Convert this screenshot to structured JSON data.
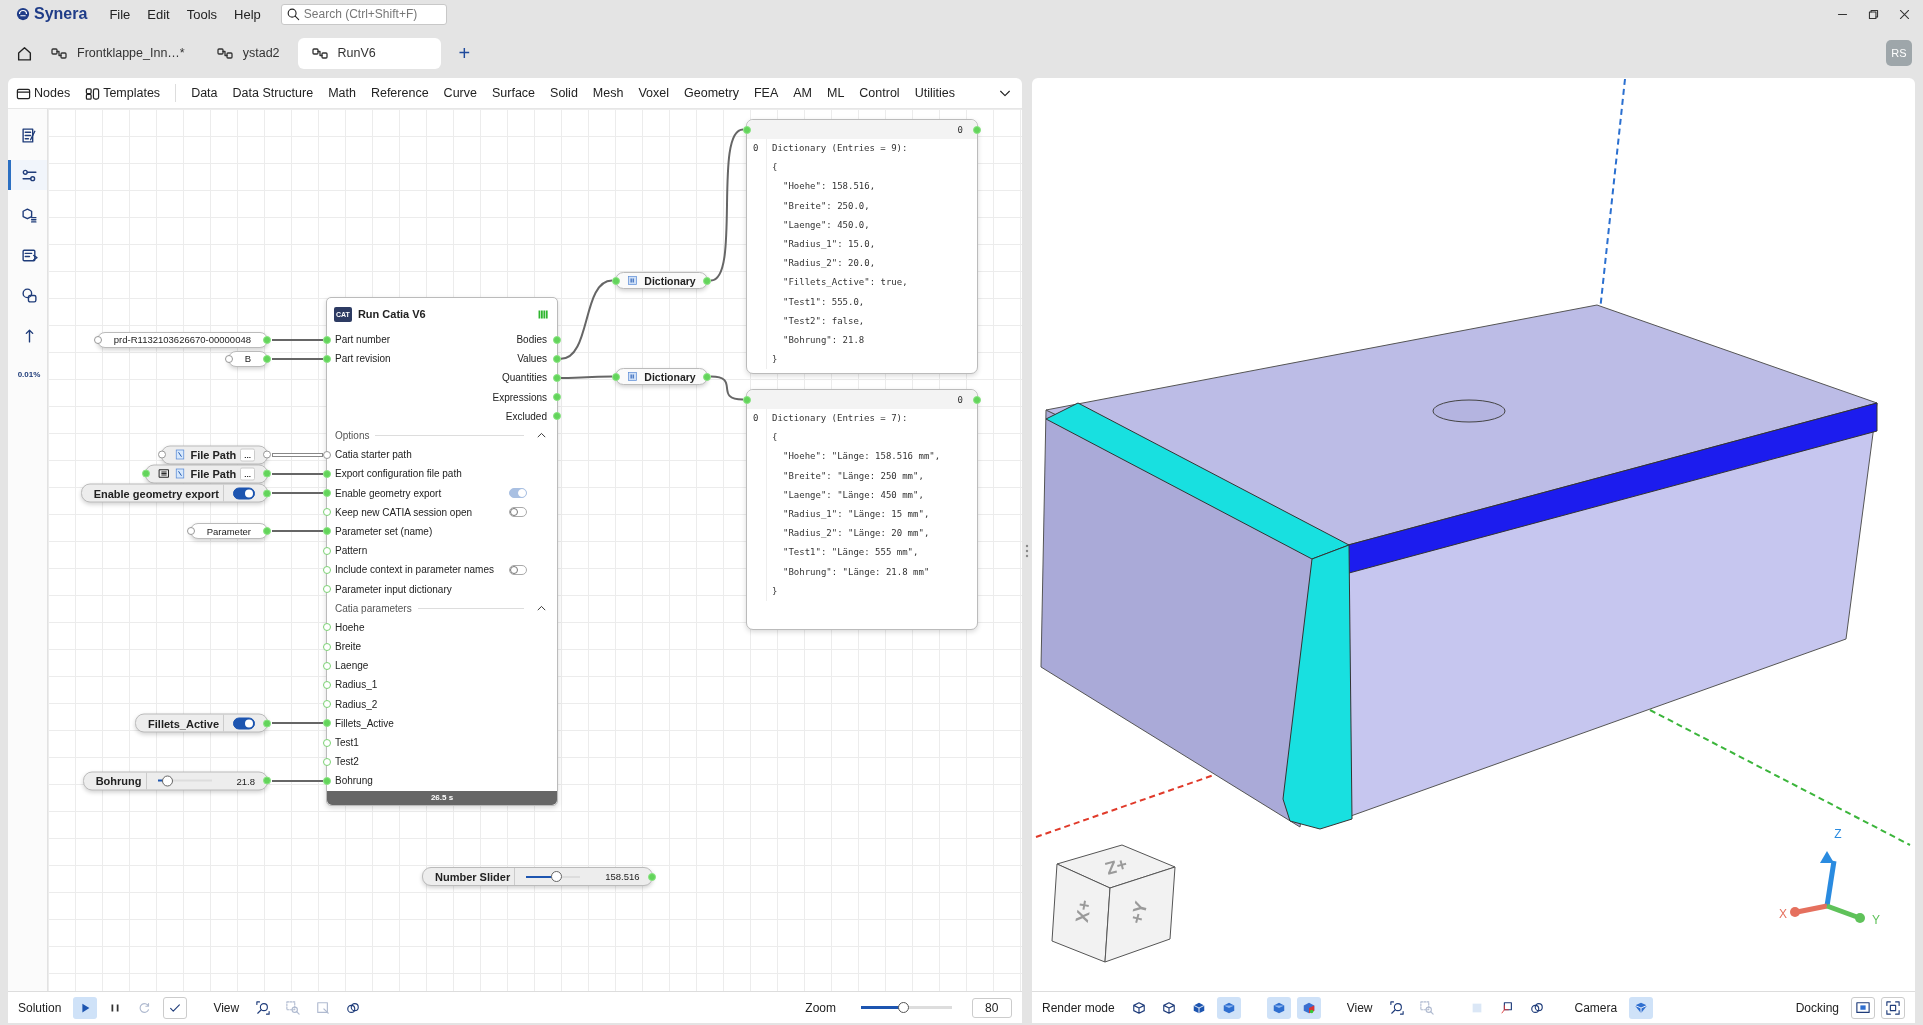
{
  "app": {
    "name": "Synera",
    "menu": [
      "File",
      "Edit",
      "Tools",
      "Help"
    ],
    "search": {
      "placeholder": "Search (Ctrl+Shift+F)"
    }
  },
  "tabs": [
    {
      "label": "Frontklappe_Inn…*",
      "selected": false
    },
    {
      "label": "ystad2",
      "selected": false
    },
    {
      "label": "RunV6",
      "selected": true
    }
  ],
  "add_tab": "+",
  "user": {
    "initials": "RS"
  },
  "node_toolbar": {
    "items": [
      {
        "kind": "nodes",
        "label": "Nodes"
      },
      {
        "kind": "templates",
        "label": "Templates"
      }
    ],
    "categories": [
      "Data",
      "Data Structure",
      "Math",
      "Reference",
      "Curve",
      "Surface",
      "Solid",
      "Mesh",
      "Voxel",
      "Geometry",
      "FEA",
      "AM",
      "ML",
      "Control",
      "Utilities"
    ]
  },
  "sidebar": {
    "items": [
      {
        "kind": "notes",
        "selected": false
      },
      {
        "kind": "sliders",
        "selected": true
      },
      {
        "kind": "cube-list",
        "selected": false
      },
      {
        "kind": "panel",
        "selected": false
      },
      {
        "kind": "shapes",
        "selected": false
      },
      {
        "kind": "arrow-up",
        "selected": false
      },
      {
        "kind": "format",
        "selected": false,
        "label": "0.01%"
      }
    ]
  },
  "canvas": {
    "node": {
      "badge": "CAT",
      "title": "Run Catia V6",
      "duration": "26.5 s",
      "rows": [
        {
          "kind": "port",
          "input": "Part number",
          "output": "Bodies",
          "connected": true,
          "source": {
            "kind": "text",
            "value": "prd-R1132103626670-00000048"
          }
        },
        {
          "kind": "port",
          "input": "Part revision",
          "output": "Values",
          "output_connected": true,
          "connected": true,
          "source": {
            "kind": "text",
            "value": "B"
          }
        },
        {
          "kind": "port",
          "output": "Quantities",
          "output_connected": true
        },
        {
          "kind": "port",
          "output": "Expressions"
        },
        {
          "kind": "port",
          "output": "Excluded"
        },
        {
          "kind": "section",
          "label": "Options",
          "expanded": true
        },
        {
          "kind": "port",
          "input": "Catia starter path",
          "connected": false,
          "source": {
            "kind": "file",
            "label": "File Path",
            "button": "...",
            "list": false
          }
        },
        {
          "kind": "port",
          "input": "Export configuration file path",
          "connected": true,
          "source": {
            "kind": "file",
            "label": "File Path",
            "button": "...",
            "list": true
          }
        },
        {
          "kind": "port",
          "input": "Enable geometry export",
          "connected": true,
          "toggle": {
            "on": true,
            "disabled": true
          },
          "source": {
            "kind": "toggle",
            "label": "Enable geometry export",
            "on": true
          }
        },
        {
          "kind": "port",
          "input": "Keep new CATIA session open",
          "connected": false,
          "toggle": {
            "on": false,
            "disabled": false
          }
        },
        {
          "kind": "port",
          "input": "Parameter set (name)",
          "connected": true,
          "source": {
            "kind": "text",
            "value": "Parameter"
          }
        },
        {
          "kind": "port",
          "input": "Pattern",
          "connected": false
        },
        {
          "kind": "port",
          "input": "Include context in parameter names",
          "connected": false,
          "toggle": {
            "on": false,
            "disabled": false
          }
        },
        {
          "kind": "port",
          "input": "Parameter input dictionary",
          "connected": false
        },
        {
          "kind": "section",
          "label": "Catia parameters",
          "expanded": true
        },
        {
          "kind": "port",
          "input": "Hoehe",
          "connected": false
        },
        {
          "kind": "port",
          "input": "Breite",
          "connected": false
        },
        {
          "kind": "port",
          "input": "Laenge",
          "connected": false
        },
        {
          "kind": "port",
          "input": "Radius_1",
          "connected": false
        },
        {
          "kind": "port",
          "input": "Radius_2",
          "connected": false
        },
        {
          "kind": "port",
          "input": "Fillets_Active",
          "connected": true,
          "source": {
            "kind": "toggle",
            "label": "Fillets_Active",
            "on": true
          }
        },
        {
          "kind": "port",
          "input": "Test1",
          "connected": false
        },
        {
          "kind": "port",
          "input": "Test2",
          "connected": false
        },
        {
          "kind": "port",
          "input": "Bohrung",
          "connected": true,
          "source": {
            "kind": "slider",
            "label": "Bohrung",
            "value": "21.8",
            "level": 0.17
          }
        }
      ]
    },
    "dictionaries": [
      {
        "label": "Dictionary"
      },
      {
        "label": "Dictionary"
      }
    ],
    "panels": [
      {
        "header": "0",
        "index": "0",
        "lines": [
          {
            "kind": "line",
            "text": "Dictionary (Entries = 9):"
          },
          {
            "kind": "line",
            "text": "{"
          },
          {
            "kind": "entry",
            "text": "\"Hoehe\": 158.516,"
          },
          {
            "kind": "entry",
            "text": "\"Breite\": 250.0,"
          },
          {
            "kind": "entry",
            "text": "\"Laenge\": 450.0,"
          },
          {
            "kind": "entry",
            "text": "\"Radius_1\": 15.0,"
          },
          {
            "kind": "entry",
            "text": "\"Radius_2\": 20.0,"
          },
          {
            "kind": "entry",
            "text": "\"Fillets_Active\": true,"
          },
          {
            "kind": "entry",
            "text": "\"Test1\": 555.0,"
          },
          {
            "kind": "entry",
            "text": "\"Test2\": false,"
          },
          {
            "kind": "entry",
            "text": "\"Bohrung\": 21.8"
          },
          {
            "kind": "line",
            "text": "}"
          }
        ]
      },
      {
        "header": "0",
        "index": "0",
        "lines": [
          {
            "kind": "line",
            "text": "Dictionary (Entries = 7):"
          },
          {
            "kind": "line",
            "text": "{"
          },
          {
            "kind": "entry",
            "text": "\"Hoehe\": \"Länge: 158.516 mm\","
          },
          {
            "kind": "entry",
            "text": "\"Breite\": \"Länge: 250 mm\","
          },
          {
            "kind": "entry",
            "text": "\"Laenge\": \"Länge: 450 mm\","
          },
          {
            "kind": "entry",
            "text": "\"Radius_1\": \"Länge: 15 mm\","
          },
          {
            "kind": "entry",
            "text": "\"Radius_2\": \"Länge: 20 mm\","
          },
          {
            "kind": "entry",
            "text": "\"Test1\": \"Länge: 555 mm\","
          },
          {
            "kind": "entry",
            "text": "\"Bohrung\": \"Länge: 21.8 mm\""
          },
          {
            "kind": "line",
            "text": "}"
          }
        ]
      }
    ],
    "number_slider": {
      "label": "Number Slider",
      "value": "158.516",
      "level": 0.57
    }
  },
  "solution_bar": {
    "label": "Solution",
    "buttons": [
      {
        "kind": "play",
        "selected": true,
        "disabled": false
      },
      {
        "kind": "pause",
        "selected": false,
        "disabled": false
      },
      {
        "kind": "refresh",
        "selected": false,
        "disabled": true
      },
      {
        "kind": "check",
        "disabled": false
      }
    ],
    "view_label": "View",
    "view_buttons": [
      {
        "kind": "zoom-fit",
        "disabled": false
      },
      {
        "kind": "zoom-select",
        "disabled": true
      },
      {
        "kind": "frame",
        "disabled": true
      },
      {
        "kind": "link",
        "disabled": false
      }
    ],
    "zoom": {
      "label": "Zoom",
      "level": 0.46,
      "value": "80"
    }
  },
  "viewport": {
    "view_cube": {
      "faces": [
        "+Z",
        "+X",
        "+Y"
      ]
    },
    "axes": {
      "labels": [
        "X",
        "Y",
        "Z"
      ]
    },
    "render_label": "Render mode",
    "render_buttons": [
      {
        "kind": "wire-cube",
        "selected": false
      },
      {
        "kind": "outline-cube",
        "selected": false
      },
      {
        "kind": "solid-cube",
        "selected": false
      },
      {
        "kind": "shaded-cube",
        "selected": true
      },
      {
        "kind": "shaded-cube",
        "selected": true
      },
      {
        "kind": "color-cube",
        "selected": true
      }
    ],
    "view_label": "View",
    "view_buttons": [
      {
        "kind": "zoom-fit",
        "disabled": false
      },
      {
        "kind": "zoom-select",
        "disabled": true
      },
      {
        "kind": "grid-square",
        "disabled": true
      },
      {
        "kind": "axes-box",
        "disabled": false
      },
      {
        "kind": "link",
        "disabled": false
      }
    ],
    "camera_label": "Camera",
    "camera_buttons": [
      {
        "kind": "camera-view",
        "selected": true
      }
    ],
    "docking_label": "Docking",
    "docking_buttons": [
      {
        "kind": "dock"
      },
      {
        "kind": "fullscreen"
      }
    ]
  }
}
